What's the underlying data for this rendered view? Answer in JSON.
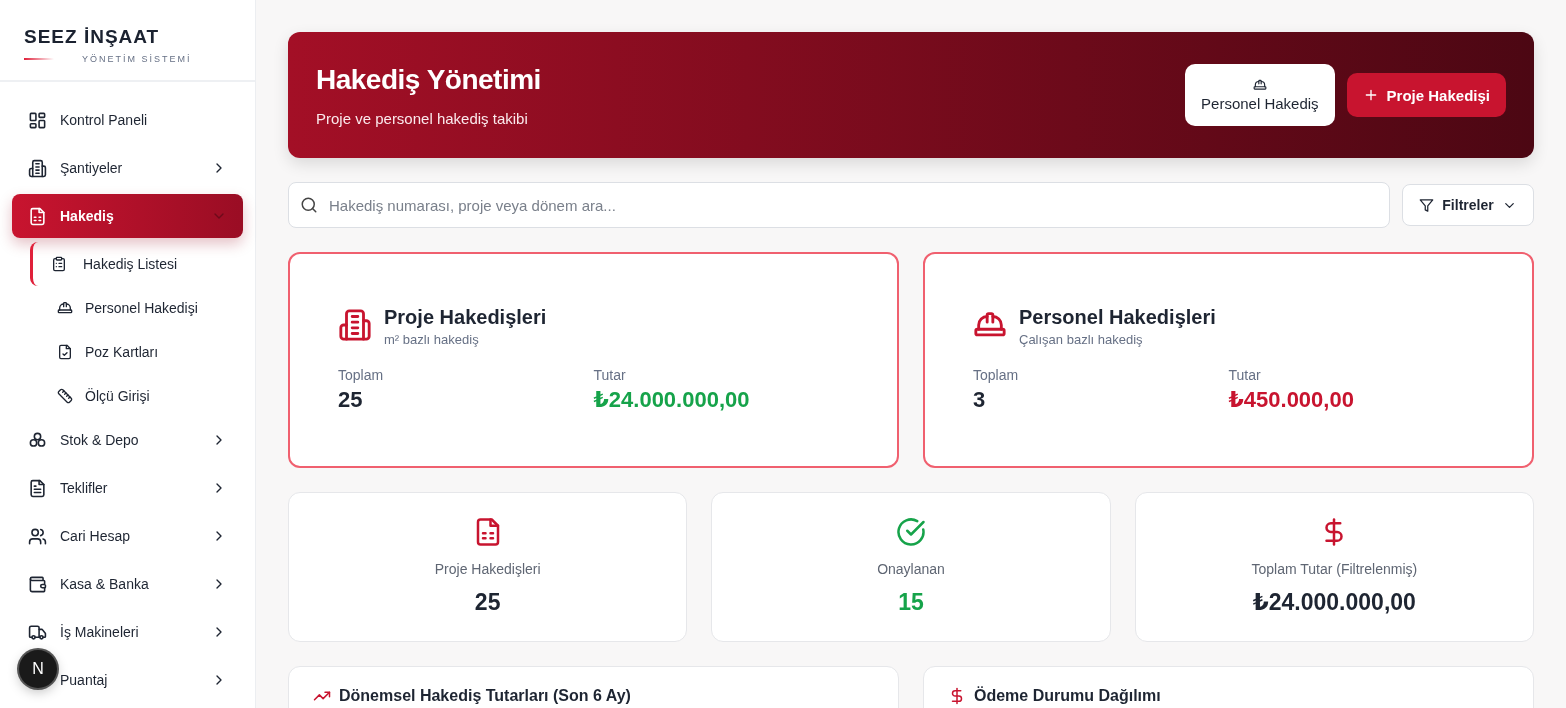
{
  "brand": {
    "name": "SEEZ İNŞAAT",
    "tagline": "YÖNETİM SİSTEMİ"
  },
  "sidebar": {
    "items": [
      {
        "label": "Kontrol Paneli",
        "kind": "link",
        "selected": false
      },
      {
        "label": "Şantiyeler",
        "kind": "group",
        "selected": false,
        "expanded": false
      },
      {
        "label": "Hakediş",
        "kind": "group",
        "selected": true,
        "expanded": true,
        "children": [
          {
            "label": "Hakediş Listesi",
            "selected": true
          },
          {
            "label": "Personel Hakedişi",
            "selected": false
          },
          {
            "label": "Poz Kartları",
            "selected": false
          },
          {
            "label": "Ölçü Girişi",
            "selected": false
          }
        ]
      },
      {
        "label": "Stok & Depo",
        "kind": "group",
        "selected": false,
        "expanded": false
      },
      {
        "label": "Teklifler",
        "kind": "group",
        "selected": false,
        "expanded": false
      },
      {
        "label": "Cari Hesap",
        "kind": "group",
        "selected": false,
        "expanded": false
      },
      {
        "label": "Kasa & Banka",
        "kind": "group",
        "selected": false,
        "expanded": false
      },
      {
        "label": "İş Makineleri",
        "kind": "group",
        "selected": false,
        "expanded": false
      },
      {
        "label": "Puantaj",
        "kind": "group",
        "selected": false,
        "expanded": false
      }
    ],
    "dev_badge": "N"
  },
  "header": {
    "title": "Hakediş Yönetimi",
    "subtitle": "Proje ve personel hakediş takibi",
    "buttons": [
      {
        "label": "Personel Hakediş",
        "kind": "secondary"
      },
      {
        "label": "Proje Hakedişi",
        "kind": "primary"
      }
    ]
  },
  "search": {
    "placeholder": "Hakediş numarası, proje veya dönem ara...",
    "filter_button": "Filtreler"
  },
  "feature_cards": [
    {
      "title": "Proje Hakedişleri",
      "subtitle": "m² bazlı hakediş",
      "total_label": "Toplam",
      "total": "25",
      "amount_label": "Tutar",
      "amount": "₺24.000.000,00",
      "color": "#16a34a"
    },
    {
      "title": "Personel Hakedişleri",
      "subtitle": "Çalışan bazlı hakediş",
      "total_label": "Toplam",
      "total": "3",
      "amount_label": "Tutar",
      "amount": "₺450.000,00",
      "color": "#c8142f"
    }
  ],
  "stats": [
    {
      "label": "Proje Hakedişleri",
      "value": "25",
      "color": "#1e2532"
    },
    {
      "label": "Onaylanan",
      "value": "15",
      "color": "#16a34a"
    },
    {
      "label": "Toplam Tutar (Filtrelenmiş)",
      "value": "₺24.000.000,00",
      "color": "#1e2532"
    }
  ],
  "panels": [
    {
      "title": "Dönemsel Hakediş Tutarları (Son 6 Ay)"
    },
    {
      "title": "Ödeme Durumu Dağılımı"
    }
  ]
}
